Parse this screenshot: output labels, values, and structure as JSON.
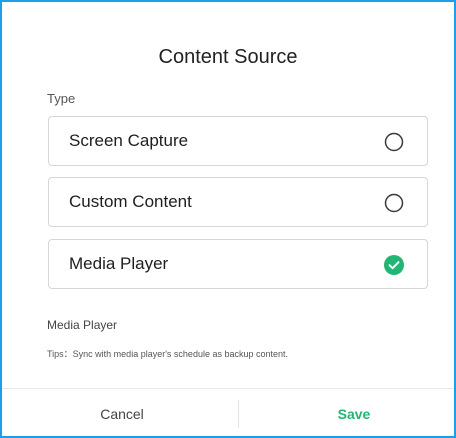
{
  "dialog": {
    "title": "Content Source",
    "section_label": "Type",
    "options": [
      {
        "label": "Screen Capture",
        "selected": false,
        "icon": "radio-empty-icon"
      },
      {
        "label": "Custom Content",
        "selected": false,
        "icon": "radio-empty-icon"
      },
      {
        "label": "Media Player",
        "selected": true,
        "icon": "check-circle-icon"
      }
    ],
    "detail": {
      "title": "Media Player",
      "tip": "Tips：Sync with media player's schedule as backup content."
    },
    "footer": {
      "cancel_label": "Cancel",
      "save_label": "Save"
    }
  },
  "colors": {
    "accent_border": "#1e9ee8",
    "selected_check": "#22b573",
    "save_text": "#22b573"
  }
}
